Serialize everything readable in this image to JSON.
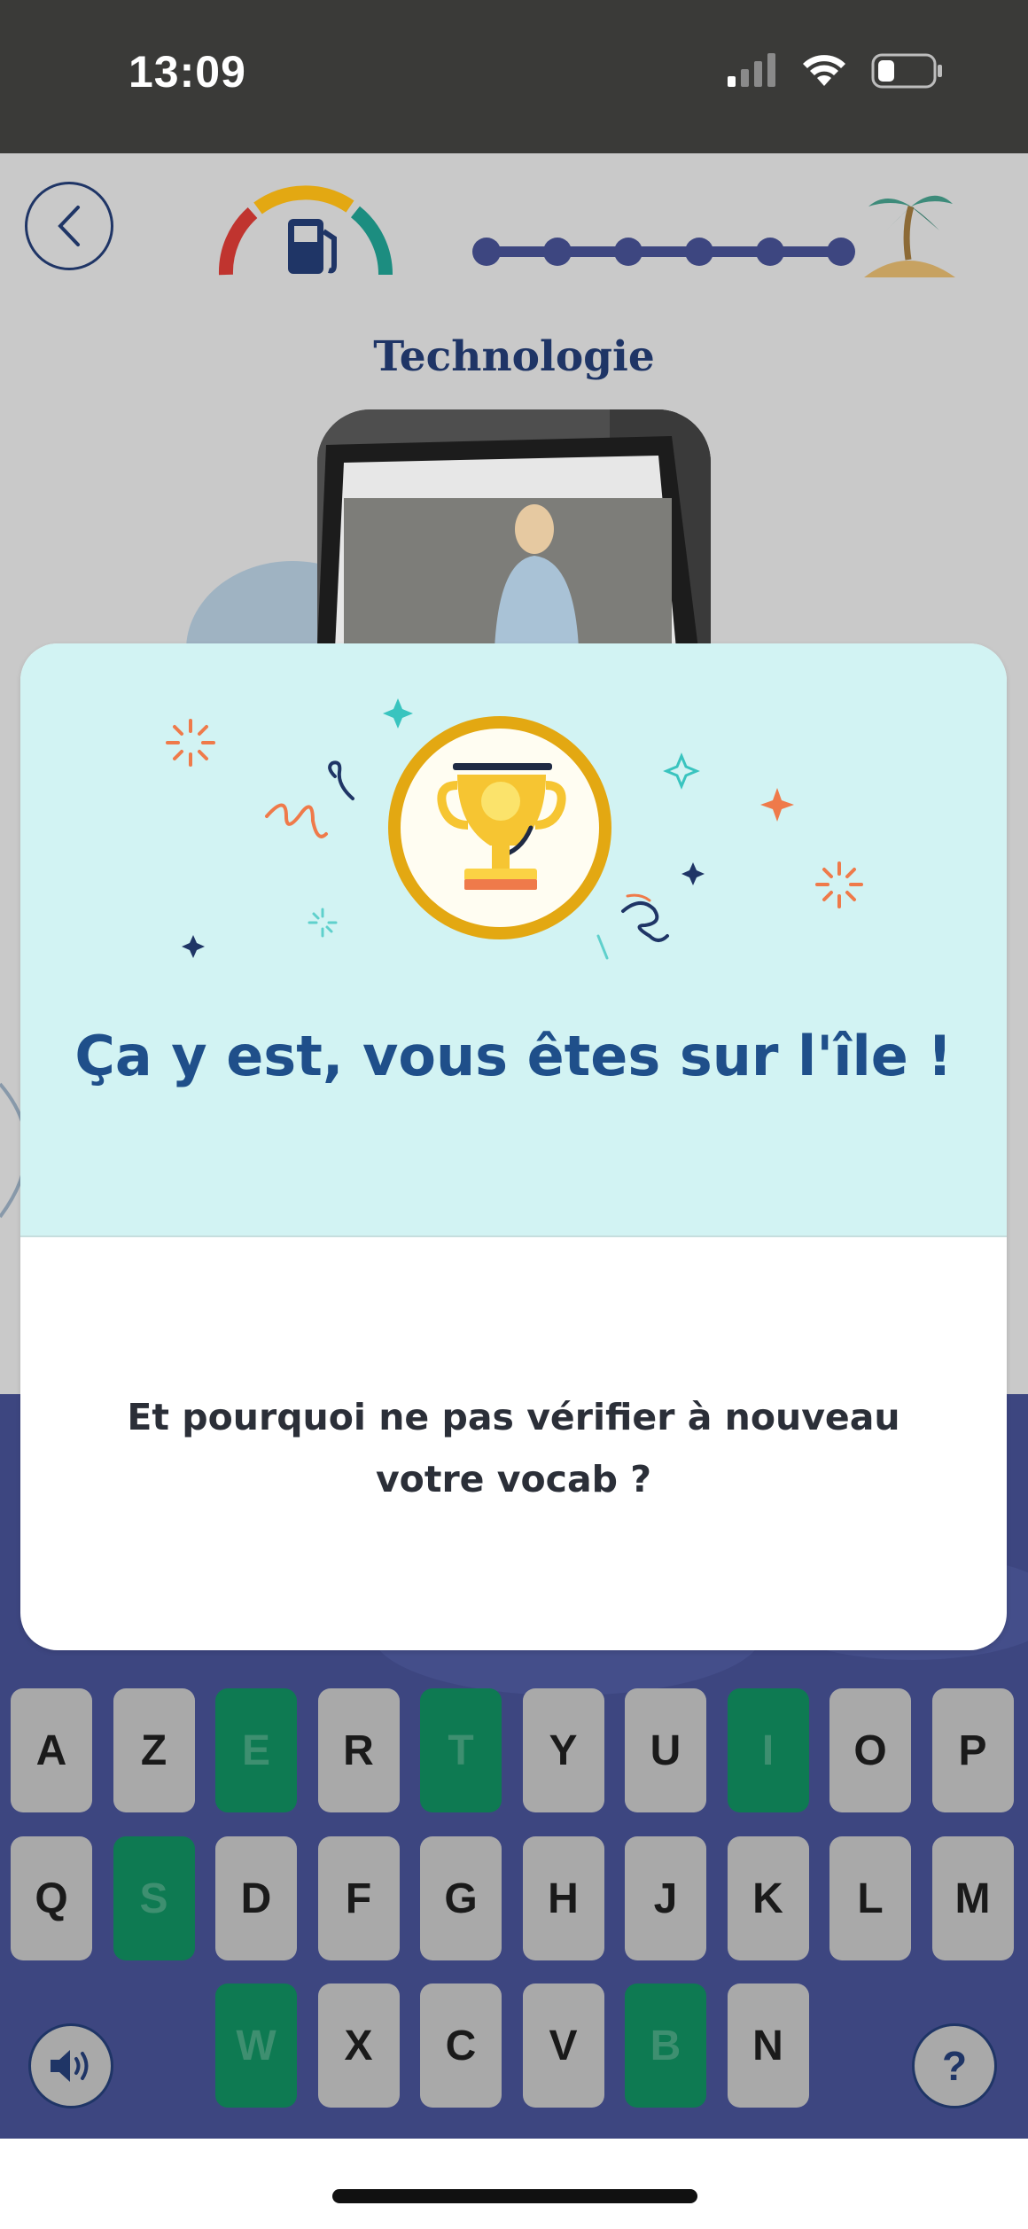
{
  "status_bar": {
    "time": "13:09"
  },
  "header": {
    "back_icon": "chevron-left-icon",
    "gauge_icon": "fuel-gauge-icon",
    "progress_steps": 6,
    "goal_icon": "palm-island-icon",
    "topic_title": "Technologie"
  },
  "modal": {
    "title": "Ça y est, vous êtes sur l'île !",
    "message": "Et pourquoi ne pas vérifier à nouveau votre vocab ?",
    "icon": "trophy-icon"
  },
  "keyboard": {
    "rows": [
      [
        {
          "label": "A",
          "state": "default"
        },
        {
          "label": "Z",
          "state": "default"
        },
        {
          "label": "E",
          "state": "used"
        },
        {
          "label": "R",
          "state": "default"
        },
        {
          "label": "T",
          "state": "used"
        },
        {
          "label": "Y",
          "state": "default"
        },
        {
          "label": "U",
          "state": "default"
        },
        {
          "label": "I",
          "state": "used"
        },
        {
          "label": "O",
          "state": "default"
        },
        {
          "label": "P",
          "state": "default"
        }
      ],
      [
        {
          "label": "Q",
          "state": "default"
        },
        {
          "label": "S",
          "state": "used"
        },
        {
          "label": "D",
          "state": "default"
        },
        {
          "label": "F",
          "state": "default"
        },
        {
          "label": "G",
          "state": "default"
        },
        {
          "label": "H",
          "state": "default"
        },
        {
          "label": "J",
          "state": "default"
        },
        {
          "label": "K",
          "state": "default"
        },
        {
          "label": "L",
          "state": "default"
        },
        {
          "label": "M",
          "state": "default"
        }
      ],
      [
        {
          "label": "W",
          "state": "used"
        },
        {
          "label": "X",
          "state": "default"
        },
        {
          "label": "C",
          "state": "default"
        },
        {
          "label": "V",
          "state": "default"
        },
        {
          "label": "B",
          "state": "used"
        },
        {
          "label": "N",
          "state": "default"
        }
      ]
    ],
    "sound_icon": "speaker-icon",
    "help_label": "?"
  },
  "colors": {
    "status_bar": "#3a3a38",
    "primary_navy": "#1f3566",
    "modal_top": "#d2f3f3",
    "key_default": "#a9a9a9",
    "key_used": "#0e7a52",
    "keyboard_band": "#3d4680",
    "trophy_gold": "#e3a812"
  }
}
